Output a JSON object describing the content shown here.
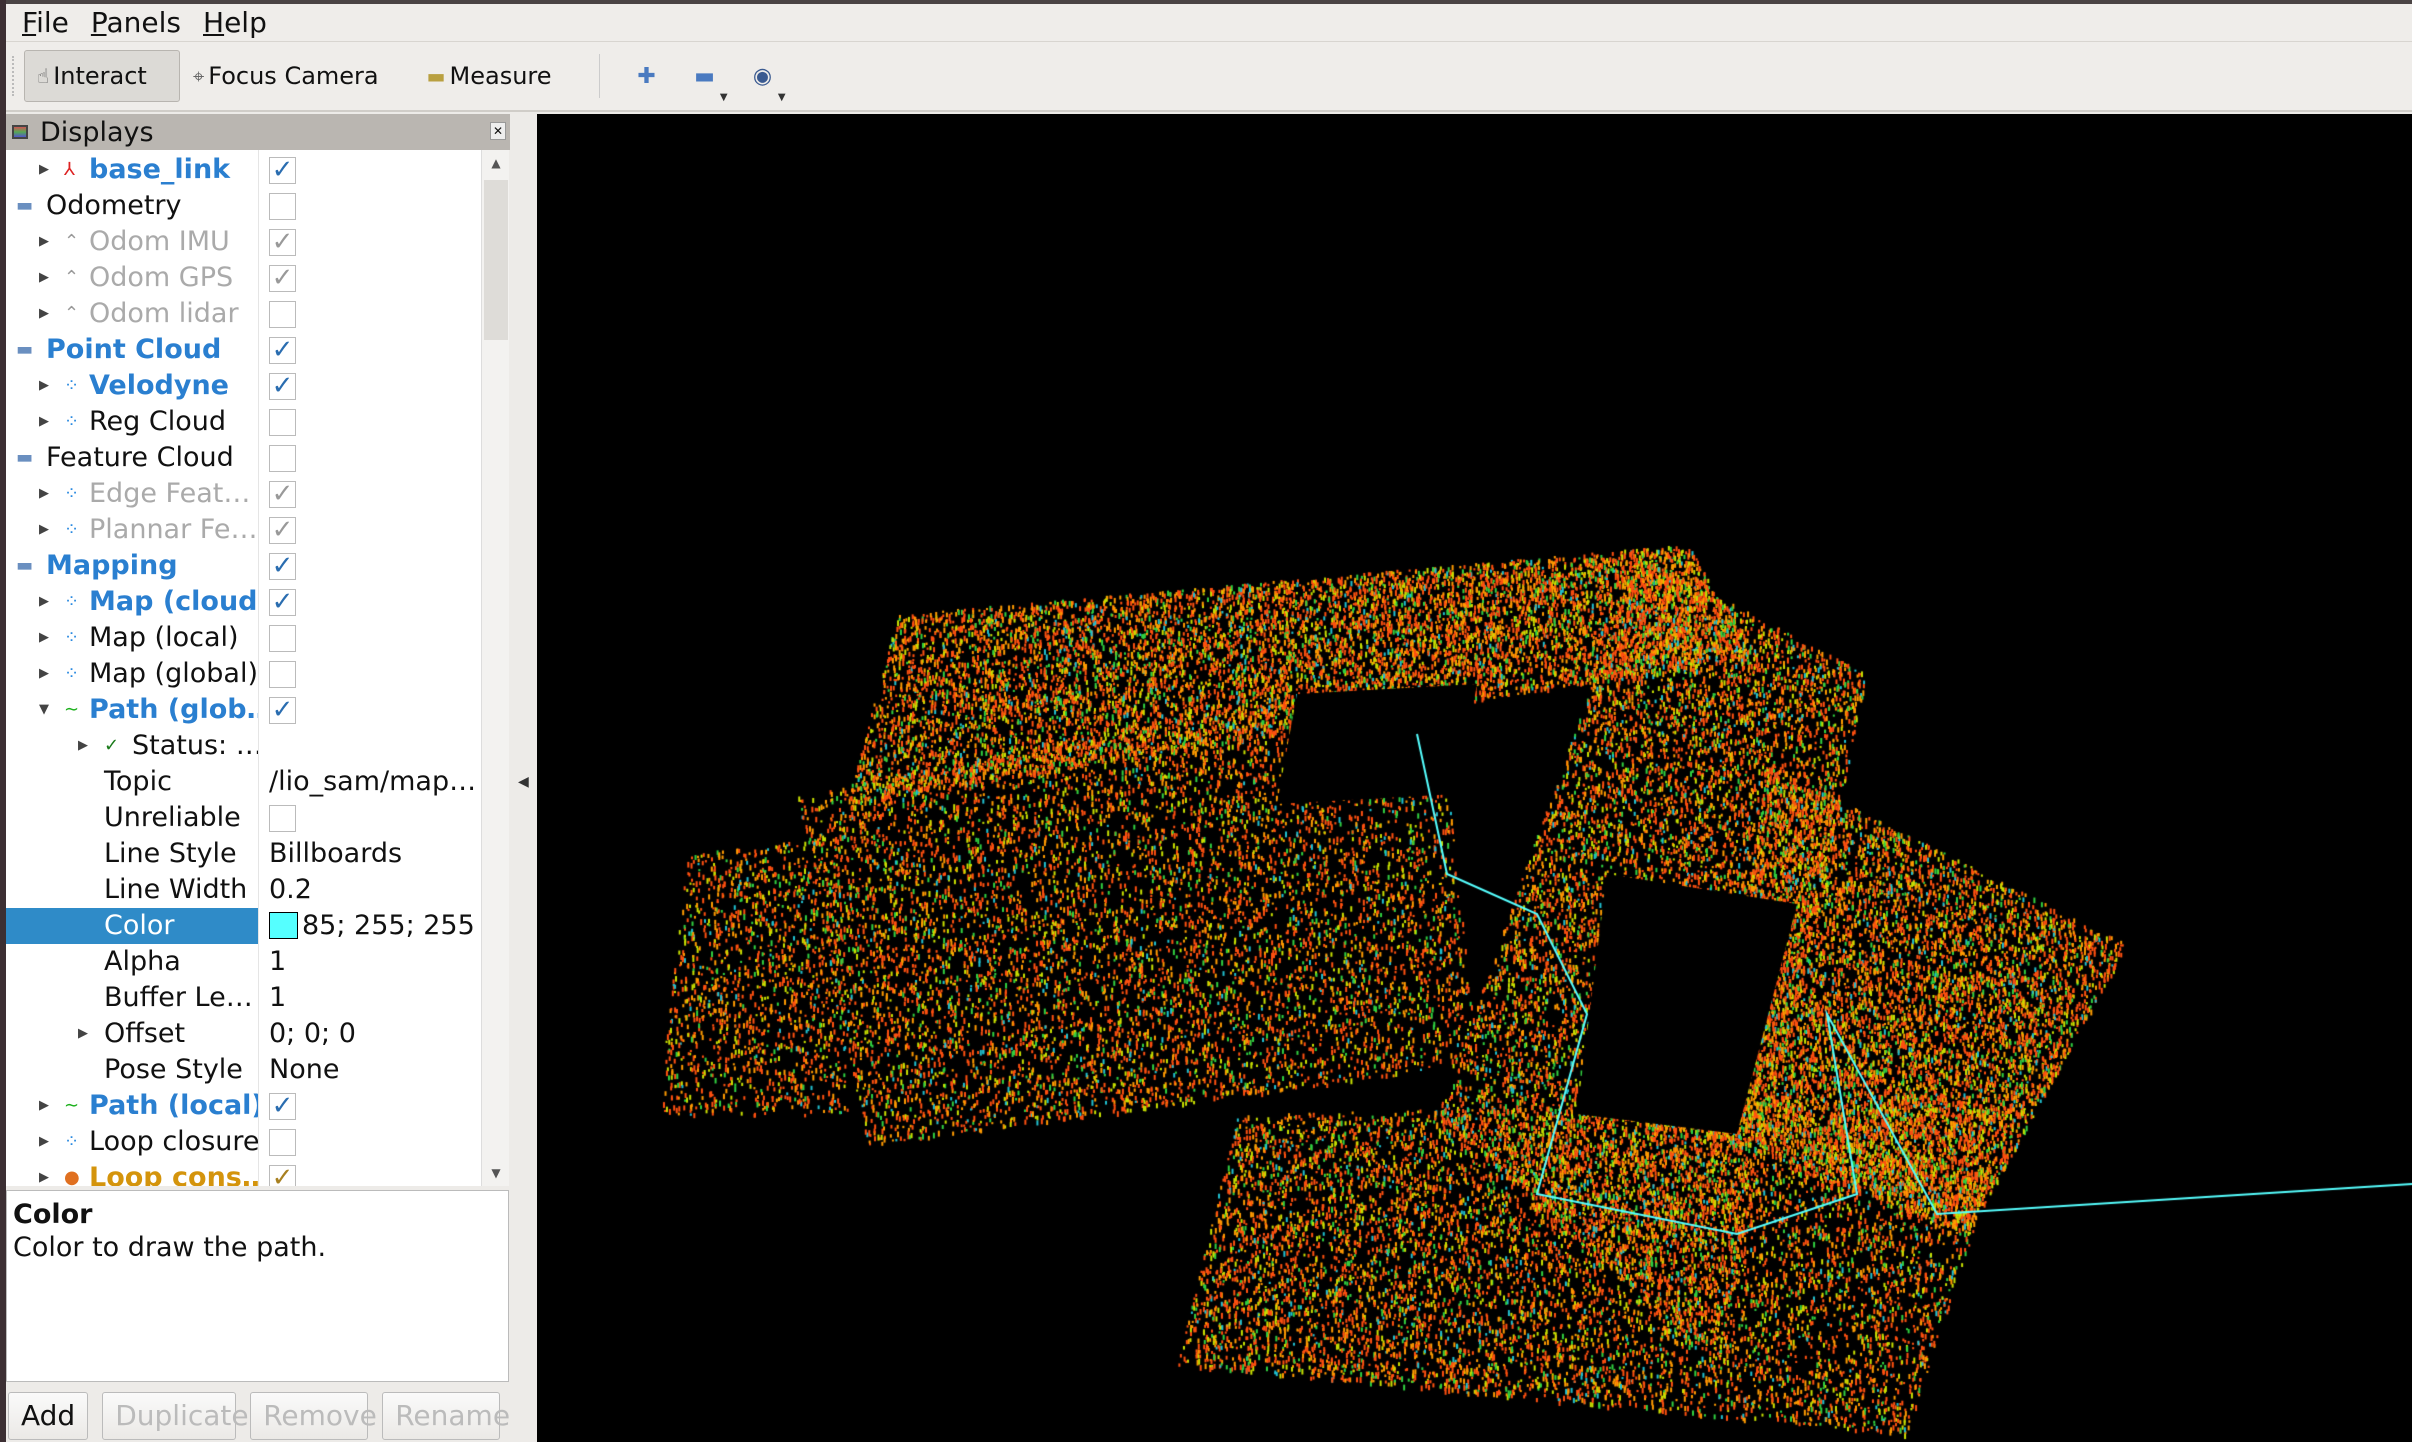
{
  "menu": [
    "File",
    "Panels",
    "Help"
  ],
  "toolbar": {
    "interact": "Interact",
    "focus_camera": "Focus Camera",
    "measure": "Measure",
    "icons": [
      "hand-icon",
      "crosshair-icon",
      "ruler-icon",
      "plus-icon",
      "minus-icon",
      "camera-eye-icon"
    ]
  },
  "displays": {
    "title": "Displays",
    "rows": [
      {
        "label": "base_link",
        "level": 1,
        "exp": "right",
        "icon": "axes-icon",
        "style": "bold",
        "check": "on"
      },
      {
        "label": "Odometry",
        "level": 0,
        "icon": "folder-icon",
        "style": "normal",
        "check": "off"
      },
      {
        "label": "Odom IMU",
        "level": 1,
        "exp": "right",
        "icon": "odometry-icon",
        "style": "gray",
        "check": "on-gray"
      },
      {
        "label": "Odom GPS",
        "level": 1,
        "exp": "right",
        "icon": "odometry-icon",
        "style": "gray",
        "check": "on-gray"
      },
      {
        "label": "Odom lidar",
        "level": 1,
        "exp": "right",
        "icon": "odometry-icon",
        "style": "gray",
        "check": "off"
      },
      {
        "label": "Point Cloud",
        "level": 0,
        "icon": "folder-icon",
        "style": "bold",
        "check": "on"
      },
      {
        "label": "Velodyne",
        "level": 1,
        "exp": "right",
        "icon": "pointcloud-icon",
        "style": "bold",
        "check": "on"
      },
      {
        "label": "Reg Cloud",
        "level": 1,
        "exp": "right",
        "icon": "pointcloud-icon",
        "style": "normal",
        "check": "off"
      },
      {
        "label": "Feature Cloud",
        "level": 0,
        "icon": "folder-icon",
        "style": "normal",
        "check": "off"
      },
      {
        "label": "Edge Feat…",
        "level": 1,
        "exp": "right",
        "icon": "pointcloud-icon",
        "style": "gray",
        "check": "on-gray"
      },
      {
        "label": "Plannar Fe…",
        "level": 1,
        "exp": "right",
        "icon": "pointcloud-icon",
        "style": "gray",
        "check": "on-gray"
      },
      {
        "label": "Mapping",
        "level": 0,
        "icon": "folder-icon",
        "style": "bold",
        "check": "on"
      },
      {
        "label": "Map (cloud)",
        "level": 1,
        "exp": "right",
        "icon": "pointcloud-icon",
        "style": "bold",
        "check": "on"
      },
      {
        "label": "Map (local)",
        "level": 1,
        "exp": "right",
        "icon": "pointcloud-icon",
        "style": "normal",
        "check": "off"
      },
      {
        "label": "Map (global)",
        "level": 1,
        "exp": "right",
        "icon": "pointcloud-icon",
        "style": "normal",
        "check": "off"
      },
      {
        "label": "Path (glob…",
        "level": 1,
        "exp": "down",
        "icon": "path-icon",
        "style": "bold",
        "check": "on"
      },
      {
        "label": "Status: …",
        "level": 2,
        "exp": "right",
        "icon": "status-ok-icon",
        "style": "normal"
      },
      {
        "label": "Topic",
        "level": 2,
        "style": "normal",
        "value": "/lio_sam/map…"
      },
      {
        "label": "Unreliable",
        "level": 2,
        "style": "normal",
        "check": "off"
      },
      {
        "label": "Line Style",
        "level": 2,
        "style": "normal",
        "value": "Billboards"
      },
      {
        "label": "Line Width",
        "level": 2,
        "style": "normal",
        "value": "0.2"
      },
      {
        "label": "Color",
        "level": 2,
        "style": "normal",
        "value": "85; 255; 255",
        "swatch": "#55ffff",
        "selected": true
      },
      {
        "label": "Alpha",
        "level": 2,
        "style": "normal",
        "value": "1"
      },
      {
        "label": "Buffer Le…",
        "level": 2,
        "style": "normal",
        "value": "1"
      },
      {
        "label": "Offset",
        "level": 2,
        "exp": "right",
        "style": "normal",
        "value": "0; 0; 0"
      },
      {
        "label": "Pose Style",
        "level": 2,
        "style": "normal",
        "value": "None"
      },
      {
        "label": "Path (local)",
        "level": 1,
        "exp": "right",
        "icon": "path-icon",
        "style": "bold",
        "check": "on"
      },
      {
        "label": "Loop closure",
        "level": 1,
        "exp": "right",
        "icon": "pointcloud-icon",
        "style": "normal",
        "check": "off"
      },
      {
        "label": "Loop cons…",
        "level": 1,
        "exp": "right",
        "icon": "warning-icon",
        "style": "warn",
        "check": "on-warn"
      }
    ]
  },
  "description": {
    "title": "Color",
    "text": "Color to draw the path."
  },
  "buttons": {
    "add": "Add",
    "duplicate": "Duplicate",
    "remove": "Remove",
    "rename": "Rename"
  },
  "colors": {
    "selection": "#2f8bc8",
    "bold_label": "#2a7fd0",
    "warning": "#d4940c",
    "path_color": "#55ffff",
    "viewport_bg": "#000000"
  }
}
